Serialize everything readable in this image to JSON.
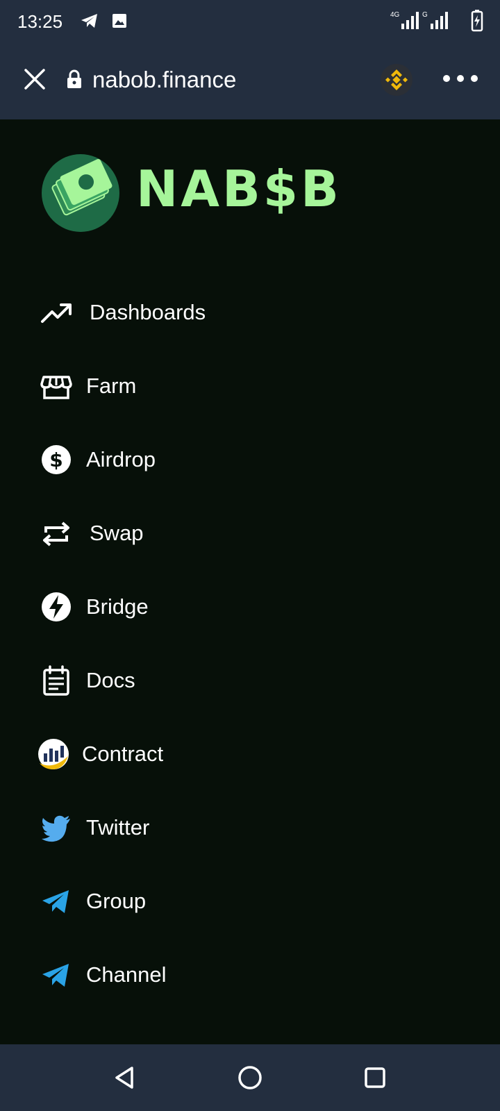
{
  "status_bar": {
    "time": "13:25",
    "network_type_1": "4G",
    "network_type_2": "G",
    "icons": [
      "telegram-icon",
      "image-icon",
      "signal-icon",
      "signal-icon",
      "battery-charging-icon"
    ]
  },
  "browser": {
    "url": "nabob.finance",
    "close_icon": "close-icon",
    "lock_icon": "lock-icon",
    "site_icon": "binance-icon",
    "menu_icon": "more-horizontal-icon"
  },
  "logo": {
    "text": "NAB$B",
    "color": "#a6f59a"
  },
  "menu": {
    "items": [
      {
        "label": "Dashboards",
        "icon": "trending-up-icon"
      },
      {
        "label": "Farm",
        "icon": "storefront-icon"
      },
      {
        "label": "Airdrop",
        "icon": "dollar-circle-icon"
      },
      {
        "label": "Swap",
        "icon": "repeat-icon"
      },
      {
        "label": "Bridge",
        "icon": "bolt-circle-icon"
      },
      {
        "label": "Docs",
        "icon": "document-icon"
      },
      {
        "label": "Contract",
        "icon": "bscscan-icon"
      },
      {
        "label": "Twitter",
        "icon": "twitter-icon"
      },
      {
        "label": "Group",
        "icon": "telegram-icon"
      },
      {
        "label": "Channel",
        "icon": "telegram-icon"
      }
    ]
  },
  "colors": {
    "background": "#071009",
    "bars": "#232e3f",
    "text": "#ffffff",
    "twitter": "#55acee",
    "telegram": "#2aa3e6",
    "binance": "#f0b90b"
  }
}
